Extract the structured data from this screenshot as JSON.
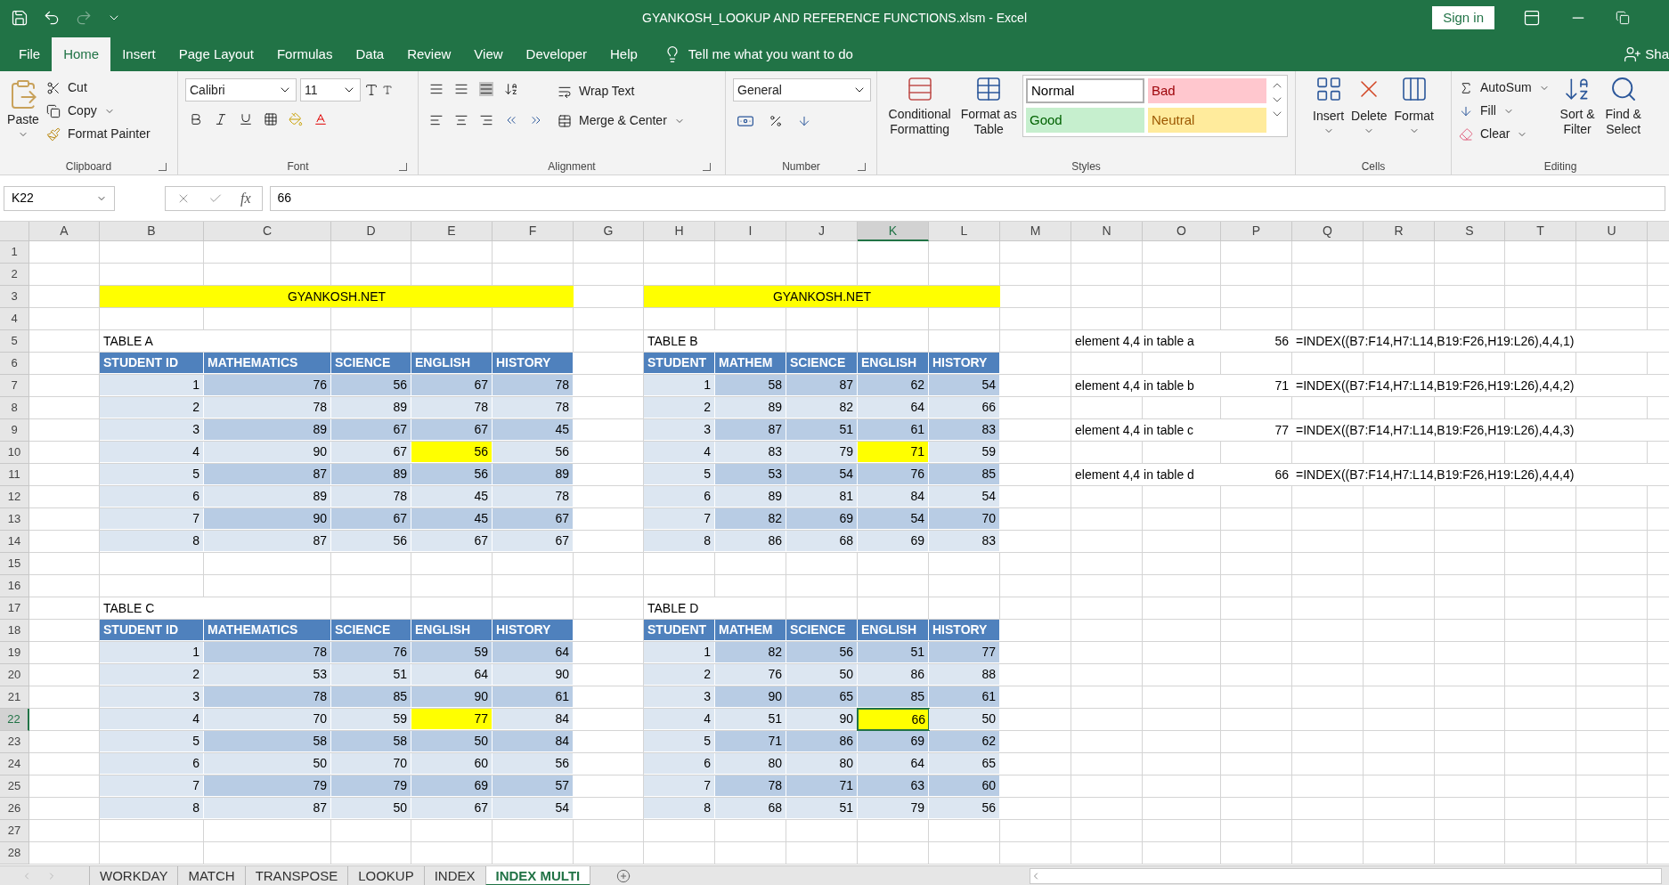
{
  "window": {
    "title": "GYANKOSH_LOOKUP AND REFERENCE FUNCTIONS.xlsm  -  Excel",
    "sign_in": "Sign in"
  },
  "menu_tabs": [
    {
      "label": "File",
      "selected": false
    },
    {
      "label": "Home",
      "selected": true
    },
    {
      "label": "Insert",
      "selected": false
    },
    {
      "label": "Page Layout",
      "selected": false
    },
    {
      "label": "Formulas",
      "selected": false
    },
    {
      "label": "Data",
      "selected": false
    },
    {
      "label": "Review",
      "selected": false
    },
    {
      "label": "View",
      "selected": false
    },
    {
      "label": "Developer",
      "selected": false
    },
    {
      "label": "Help",
      "selected": false
    }
  ],
  "tell_me": "Tell me what you want to do",
  "share": "Sha",
  "ribbon": {
    "clipboard": {
      "paste": "Paste",
      "cut": "Cut",
      "copy": "Copy",
      "format_painter": "Format Painter",
      "label": "Clipboard"
    },
    "font": {
      "name": "Calibri",
      "size": "11",
      "label": "Font"
    },
    "alignment": {
      "wrap": "Wrap Text",
      "merge": "Merge & Center",
      "label": "Alignment"
    },
    "number": {
      "format": "General",
      "label": "Number"
    },
    "styles": {
      "conditional": [
        "Conditional",
        "Formatting"
      ],
      "format_table": [
        "Format as",
        "Table"
      ],
      "label": "Styles",
      "cell_styles": [
        {
          "label": "Normal",
          "color": "#ffffff",
          "selected": true
        },
        {
          "label": "Bad",
          "color": "#ffc7ce",
          "selected": false
        },
        {
          "label": "Good",
          "color": "#c6efce",
          "selected": false
        },
        {
          "label": "Neutral",
          "color": "#ffeb9c",
          "selected": false
        }
      ]
    },
    "cells": {
      "buttons": [
        "Insert",
        "Delete",
        "Format"
      ],
      "label": "Cells"
    },
    "editing": {
      "autosum": "AutoSum",
      "fill": "Fill",
      "clear": "Clear",
      "sort": [
        "Sort &",
        "Filter"
      ],
      "find": [
        "Find &",
        "Select"
      ],
      "label": "Editing"
    }
  },
  "formula_bar": {
    "name_box": "K22",
    "fx": "fx",
    "value": "66"
  },
  "columns": [
    {
      "label": "A",
      "selected": false
    },
    {
      "label": "B",
      "selected": false
    },
    {
      "label": "C",
      "selected": false
    },
    {
      "label": "D",
      "selected": false
    },
    {
      "label": "E",
      "selected": false
    },
    {
      "label": "F",
      "selected": false
    },
    {
      "label": "G",
      "selected": false
    },
    {
      "label": "H",
      "selected": false
    },
    {
      "label": "I",
      "selected": false
    },
    {
      "label": "J",
      "selected": false
    },
    {
      "label": "K",
      "selected": true
    },
    {
      "label": "L",
      "selected": false
    },
    {
      "label": "M",
      "selected": false
    },
    {
      "label": "N",
      "selected": false
    },
    {
      "label": "O",
      "selected": false
    },
    {
      "label": "P",
      "selected": false
    },
    {
      "label": "Q",
      "selected": false
    },
    {
      "label": "R",
      "selected": false
    },
    {
      "label": "S",
      "selected": false
    },
    {
      "label": "T",
      "selected": false
    },
    {
      "label": "U",
      "selected": false
    }
  ],
  "rows": [
    {
      "number": "1",
      "selected": false,
      "cells": []
    },
    {
      "number": "2",
      "selected": false,
      "cells": []
    },
    {
      "number": "3",
      "selected": false,
      "cells": [
        {
          "kind": "blank"
        },
        {
          "kind": "banner",
          "text": "GYANKOSH.NET"
        },
        {
          "kind": "blank"
        },
        {
          "kind": "banner",
          "text": "GYANKOSH.NET"
        }
      ]
    },
    {
      "number": "4",
      "selected": false,
      "cells": []
    },
    {
      "number": "5",
      "selected": false,
      "cells": [
        {
          "kind": "blank"
        },
        {
          "kind": "title",
          "text": "TABLE A"
        },
        {
          "kind": "blank"
        },
        {
          "kind": "blank"
        },
        {
          "kind": "blank"
        },
        {
          "kind": "blank"
        },
        {
          "kind": "blank"
        },
        {
          "kind": "title",
          "text": "TABLE B"
        },
        {
          "kind": "blank"
        },
        {
          "kind": "blank"
        },
        {
          "kind": "blank"
        },
        {
          "kind": "blank"
        },
        {
          "kind": "blank"
        },
        {
          "kind": "note",
          "text": "element 4,4 in table a"
        },
        {
          "kind": "number",
          "text": "56"
        },
        {
          "kind": "formula",
          "text": "=INDEX((B7:F14,H7:L14,B19:F26,H19:L26),4,4,1)"
        }
      ]
    },
    {
      "number": "6",
      "selected": false,
      "cells": [
        {
          "kind": "blank"
        },
        {
          "kind": "header",
          "text": "STUDENT ID"
        },
        {
          "kind": "header",
          "text": "MATHEMATICS"
        },
        {
          "kind": "header",
          "text": "SCIENCE"
        },
        {
          "kind": "header",
          "text": "ENGLISH"
        },
        {
          "kind": "header",
          "text": "HISTORY"
        },
        {
          "kind": "blank"
        },
        {
          "kind": "header",
          "text": "STUDENT"
        },
        {
          "kind": "header",
          "text": "MATHEM"
        },
        {
          "kind": "header",
          "text": "SCIENCE"
        },
        {
          "kind": "header",
          "text": "ENGLISH"
        },
        {
          "kind": "header",
          "text": "HISTORY"
        }
      ]
    },
    {
      "number": "7",
      "selected": false,
      "cells": [
        {
          "kind": "blank"
        },
        {
          "kind": "id",
          "text": "1"
        },
        {
          "kind": "dark",
          "text": "76"
        },
        {
          "kind": "dark",
          "text": "56"
        },
        {
          "kind": "dark",
          "text": "67"
        },
        {
          "kind": "dark",
          "text": "78"
        },
        {
          "kind": "blank"
        },
        {
          "kind": "id",
          "text": "1"
        },
        {
          "kind": "dark",
          "text": "58"
        },
        {
          "kind": "dark",
          "text": "87"
        },
        {
          "kind": "dark",
          "text": "62"
        },
        {
          "kind": "dark",
          "text": "54"
        },
        {
          "kind": "blank"
        },
        {
          "kind": "note",
          "text": "element 4,4 in table b"
        },
        {
          "kind": "number",
          "text": "71"
        },
        {
          "kind": "formula",
          "text": "=INDEX((B7:F14,H7:L14,B19:F26,H19:L26),4,4,2)"
        }
      ]
    },
    {
      "number": "8",
      "selected": false,
      "cells": [
        {
          "kind": "blank"
        },
        {
          "kind": "id",
          "text": "2"
        },
        {
          "kind": "light",
          "text": "78"
        },
        {
          "kind": "light",
          "text": "89"
        },
        {
          "kind": "light",
          "text": "78"
        },
        {
          "kind": "light",
          "text": "78"
        },
        {
          "kind": "blank"
        },
        {
          "kind": "id",
          "text": "2"
        },
        {
          "kind": "light",
          "text": "89"
        },
        {
          "kind": "light",
          "text": "82"
        },
        {
          "kind": "light",
          "text": "64"
        },
        {
          "kind": "light",
          "text": "66"
        }
      ]
    },
    {
      "number": "9",
      "selected": false,
      "cells": [
        {
          "kind": "blank"
        },
        {
          "kind": "id",
          "text": "3"
        },
        {
          "kind": "dark",
          "text": "89"
        },
        {
          "kind": "dark",
          "text": "67"
        },
        {
          "kind": "dark",
          "text": "67"
        },
        {
          "kind": "dark",
          "text": "45"
        },
        {
          "kind": "blank"
        },
        {
          "kind": "id",
          "text": "3"
        },
        {
          "kind": "dark",
          "text": "87"
        },
        {
          "kind": "dark",
          "text": "51"
        },
        {
          "kind": "dark",
          "text": "61"
        },
        {
          "kind": "dark",
          "text": "83"
        },
        {
          "kind": "blank"
        },
        {
          "kind": "note",
          "text": "element 4,4 in table c"
        },
        {
          "kind": "number",
          "text": "77"
        },
        {
          "kind": "formula",
          "text": "=INDEX((B7:F14,H7:L14,B19:F26,H19:L26),4,4,3)"
        }
      ]
    },
    {
      "number": "10",
      "selected": false,
      "cells": [
        {
          "kind": "blank"
        },
        {
          "kind": "id",
          "text": "4"
        },
        {
          "kind": "light",
          "text": "90"
        },
        {
          "kind": "light",
          "text": "67"
        },
        {
          "kind": "highlight",
          "text": "56"
        },
        {
          "kind": "light",
          "text": "56"
        },
        {
          "kind": "blank"
        },
        {
          "kind": "id",
          "text": "4"
        },
        {
          "kind": "light",
          "text": "83"
        },
        {
          "kind": "light",
          "text": "79"
        },
        {
          "kind": "highlight",
          "text": "71"
        },
        {
          "kind": "light",
          "text": "59"
        }
      ]
    },
    {
      "number": "11",
      "selected": false,
      "cells": [
        {
          "kind": "blank"
        },
        {
          "kind": "id",
          "text": "5"
        },
        {
          "kind": "dark",
          "text": "87"
        },
        {
          "kind": "dark",
          "text": "89"
        },
        {
          "kind": "dark",
          "text": "56"
        },
        {
          "kind": "dark",
          "text": "89"
        },
        {
          "kind": "blank"
        },
        {
          "kind": "id",
          "text": "5"
        },
        {
          "kind": "dark",
          "text": "53"
        },
        {
          "kind": "dark",
          "text": "54"
        },
        {
          "kind": "dark",
          "text": "76"
        },
        {
          "kind": "dark",
          "text": "85"
        },
        {
          "kind": "blank"
        },
        {
          "kind": "note",
          "text": "element 4,4 in table d"
        },
        {
          "kind": "number",
          "text": "66"
        },
        {
          "kind": "formula",
          "text": "=INDEX((B7:F14,H7:L14,B19:F26,H19:L26),4,4,4)"
        }
      ]
    },
    {
      "number": "12",
      "selected": false,
      "cells": [
        {
          "kind": "blank"
        },
        {
          "kind": "id",
          "text": "6"
        },
        {
          "kind": "light",
          "text": "89"
        },
        {
          "kind": "light",
          "text": "78"
        },
        {
          "kind": "light",
          "text": "45"
        },
        {
          "kind": "light",
          "text": "78"
        },
        {
          "kind": "blank"
        },
        {
          "kind": "id",
          "text": "6"
        },
        {
          "kind": "light",
          "text": "89"
        },
        {
          "kind": "light",
          "text": "81"
        },
        {
          "kind": "light",
          "text": "84"
        },
        {
          "kind": "light",
          "text": "54"
        }
      ]
    },
    {
      "number": "13",
      "selected": false,
      "cells": [
        {
          "kind": "blank"
        },
        {
          "kind": "id",
          "text": "7"
        },
        {
          "kind": "dark",
          "text": "90"
        },
        {
          "kind": "dark",
          "text": "67"
        },
        {
          "kind": "dark",
          "text": "45"
        },
        {
          "kind": "dark",
          "text": "67"
        },
        {
          "kind": "blank"
        },
        {
          "kind": "id",
          "text": "7"
        },
        {
          "kind": "dark",
          "text": "82"
        },
        {
          "kind": "dark",
          "text": "69"
        },
        {
          "kind": "dark",
          "text": "54"
        },
        {
          "kind": "dark",
          "text": "70"
        }
      ]
    },
    {
      "number": "14",
      "selected": false,
      "cells": [
        {
          "kind": "blank"
        },
        {
          "kind": "id",
          "text": "8"
        },
        {
          "kind": "light",
          "text": "87"
        },
        {
          "kind": "light",
          "text": "56"
        },
        {
          "kind": "light",
          "text": "67"
        },
        {
          "kind": "light",
          "text": "67"
        },
        {
          "kind": "blank"
        },
        {
          "kind": "id",
          "text": "8"
        },
        {
          "kind": "light",
          "text": "86"
        },
        {
          "kind": "light",
          "text": "68"
        },
        {
          "kind": "light",
          "text": "69"
        },
        {
          "kind": "light",
          "text": "83"
        }
      ]
    },
    {
      "number": "15",
      "selected": false,
      "cells": []
    },
    {
      "number": "16",
      "selected": false,
      "cells": []
    },
    {
      "number": "17",
      "selected": false,
      "cells": [
        {
          "kind": "blank"
        },
        {
          "kind": "title",
          "text": "TABLE C"
        },
        {
          "kind": "blank"
        },
        {
          "kind": "blank"
        },
        {
          "kind": "blank"
        },
        {
          "kind": "blank"
        },
        {
          "kind": "blank"
        },
        {
          "kind": "title",
          "text": "TABLE D"
        }
      ]
    },
    {
      "number": "18",
      "selected": false,
      "cells": [
        {
          "kind": "blank"
        },
        {
          "kind": "header",
          "text": "STUDENT ID"
        },
        {
          "kind": "header",
          "text": "MATHEMATICS"
        },
        {
          "kind": "header",
          "text": "SCIENCE"
        },
        {
          "kind": "header",
          "text": "ENGLISH"
        },
        {
          "kind": "header",
          "text": "HISTORY"
        },
        {
          "kind": "blank"
        },
        {
          "kind": "header",
          "text": "STUDENT"
        },
        {
          "kind": "header",
          "text": "MATHEM"
        },
        {
          "kind": "header",
          "text": "SCIENCE"
        },
        {
          "kind": "header",
          "text": "ENGLISH"
        },
        {
          "kind": "header",
          "text": "HISTORY"
        }
      ]
    },
    {
      "number": "19",
      "selected": false,
      "cells": [
        {
          "kind": "blank"
        },
        {
          "kind": "id",
          "text": "1"
        },
        {
          "kind": "dark",
          "text": "78"
        },
        {
          "kind": "dark",
          "text": "76"
        },
        {
          "kind": "dark",
          "text": "59"
        },
        {
          "kind": "dark",
          "text": "64"
        },
        {
          "kind": "blank"
        },
        {
          "kind": "id",
          "text": "1"
        },
        {
          "kind": "dark",
          "text": "82"
        },
        {
          "kind": "dark",
          "text": "56"
        },
        {
          "kind": "dark",
          "text": "51"
        },
        {
          "kind": "dark",
          "text": "77"
        }
      ]
    },
    {
      "number": "20",
      "selected": false,
      "cells": [
        {
          "kind": "blank"
        },
        {
          "kind": "id",
          "text": "2"
        },
        {
          "kind": "light",
          "text": "53"
        },
        {
          "kind": "light",
          "text": "51"
        },
        {
          "kind": "light",
          "text": "64"
        },
        {
          "kind": "light",
          "text": "90"
        },
        {
          "kind": "blank"
        },
        {
          "kind": "id",
          "text": "2"
        },
        {
          "kind": "light",
          "text": "76"
        },
        {
          "kind": "light",
          "text": "50"
        },
        {
          "kind": "light",
          "text": "86"
        },
        {
          "kind": "light",
          "text": "88"
        }
      ]
    },
    {
      "number": "21",
      "selected": false,
      "cells": [
        {
          "kind": "blank"
        },
        {
          "kind": "id",
          "text": "3"
        },
        {
          "kind": "dark",
          "text": "78"
        },
        {
          "kind": "dark",
          "text": "85"
        },
        {
          "kind": "dark",
          "text": "90"
        },
        {
          "kind": "dark",
          "text": "61"
        },
        {
          "kind": "blank"
        },
        {
          "kind": "id",
          "text": "3"
        },
        {
          "kind": "dark",
          "text": "90"
        },
        {
          "kind": "dark",
          "text": "65"
        },
        {
          "kind": "dark",
          "text": "85"
        },
        {
          "kind": "dark",
          "text": "61"
        }
      ]
    },
    {
      "number": "22",
      "selected": true,
      "cells": [
        {
          "kind": "blank"
        },
        {
          "kind": "id",
          "text": "4"
        },
        {
          "kind": "light",
          "text": "70"
        },
        {
          "kind": "light",
          "text": "59"
        },
        {
          "kind": "highlight",
          "text": "77"
        },
        {
          "kind": "light",
          "text": "84"
        },
        {
          "kind": "blank"
        },
        {
          "kind": "id",
          "text": "4"
        },
        {
          "kind": "light",
          "text": "51"
        },
        {
          "kind": "light",
          "text": "90"
        },
        {
          "kind": "active",
          "text": "66"
        },
        {
          "kind": "light",
          "text": "50"
        }
      ]
    },
    {
      "number": "23",
      "selected": false,
      "cells": [
        {
          "kind": "blank"
        },
        {
          "kind": "id",
          "text": "5"
        },
        {
          "kind": "dark",
          "text": "58"
        },
        {
          "kind": "dark",
          "text": "58"
        },
        {
          "kind": "dark",
          "text": "50"
        },
        {
          "kind": "dark",
          "text": "84"
        },
        {
          "kind": "blank"
        },
        {
          "kind": "id",
          "text": "5"
        },
        {
          "kind": "dark",
          "text": "71"
        },
        {
          "kind": "dark",
          "text": "86"
        },
        {
          "kind": "dark",
          "text": "69"
        },
        {
          "kind": "dark",
          "text": "62"
        }
      ]
    },
    {
      "number": "24",
      "selected": false,
      "cells": [
        {
          "kind": "blank"
        },
        {
          "kind": "id",
          "text": "6"
        },
        {
          "kind": "light",
          "text": "50"
        },
        {
          "kind": "light",
          "text": "70"
        },
        {
          "kind": "light",
          "text": "60"
        },
        {
          "kind": "light",
          "text": "56"
        },
        {
          "kind": "blank"
        },
        {
          "kind": "id",
          "text": "6"
        },
        {
          "kind": "light",
          "text": "80"
        },
        {
          "kind": "light",
          "text": "80"
        },
        {
          "kind": "light",
          "text": "64"
        },
        {
          "kind": "light",
          "text": "65"
        }
      ]
    },
    {
      "number": "25",
      "selected": false,
      "cells": [
        {
          "kind": "blank"
        },
        {
          "kind": "id",
          "text": "7"
        },
        {
          "kind": "dark",
          "text": "79"
        },
        {
          "kind": "dark",
          "text": "79"
        },
        {
          "kind": "dark",
          "text": "69"
        },
        {
          "kind": "dark",
          "text": "57"
        },
        {
          "kind": "blank"
        },
        {
          "kind": "id",
          "text": "7"
        },
        {
          "kind": "dark",
          "text": "78"
        },
        {
          "kind": "dark",
          "text": "71"
        },
        {
          "kind": "dark",
          "text": "63"
        },
        {
          "kind": "dark",
          "text": "60"
        }
      ]
    },
    {
      "number": "26",
      "selected": false,
      "cells": [
        {
          "kind": "blank"
        },
        {
          "kind": "id",
          "text": "8"
        },
        {
          "kind": "light",
          "text": "87"
        },
        {
          "kind": "light",
          "text": "50"
        },
        {
          "kind": "light",
          "text": "67"
        },
        {
          "kind": "light",
          "text": "54"
        },
        {
          "kind": "blank"
        },
        {
          "kind": "id",
          "text": "8"
        },
        {
          "kind": "light",
          "text": "68"
        },
        {
          "kind": "light",
          "text": "51"
        },
        {
          "kind": "light",
          "text": "79"
        },
        {
          "kind": "light",
          "text": "56"
        }
      ]
    },
    {
      "number": "27",
      "selected": false,
      "cells": []
    },
    {
      "number": "28",
      "selected": false,
      "cells": []
    }
  ],
  "sheet_tabs": [
    {
      "label": "WORKDAY",
      "selected": false
    },
    {
      "label": "MATCH",
      "selected": false
    },
    {
      "label": "TRANSPOSE",
      "selected": false
    },
    {
      "label": "LOOKUP",
      "selected": false
    },
    {
      "label": "INDEX",
      "selected": false
    },
    {
      "label": "INDEX MULTI",
      "selected": true
    }
  ]
}
